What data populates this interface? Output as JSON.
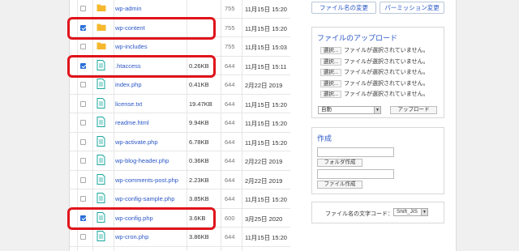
{
  "files": [
    {
      "name": "wp-admin",
      "type": "folder",
      "size": "",
      "perm": "755",
      "date": "11月15日 15:20",
      "checked": false
    },
    {
      "name": "wp-content",
      "type": "folder",
      "size": "",
      "perm": "755",
      "date": "11月15日 15:20",
      "checked": true
    },
    {
      "name": "wp-includes",
      "type": "folder",
      "size": "",
      "perm": "755",
      "date": "11月15日 15:03",
      "checked": false
    },
    {
      "name": ".htaccess",
      "type": "file",
      "size": "0.26KB",
      "perm": "644",
      "date": "11月15日 15:11",
      "checked": true
    },
    {
      "name": "index.php",
      "type": "file",
      "size": "0.41KB",
      "perm": "644",
      "date": "2月22日 2019",
      "checked": false
    },
    {
      "name": "license.txt",
      "type": "file",
      "size": "19.47KB",
      "perm": "644",
      "date": "11月15日 15:20",
      "checked": false
    },
    {
      "name": "readme.html",
      "type": "file",
      "size": "9.94KB",
      "perm": "644",
      "date": "11月15日 15:20",
      "checked": false
    },
    {
      "name": "wp-activate.php",
      "type": "file",
      "size": "6.78KB",
      "perm": "644",
      "date": "11月15日 15:20",
      "checked": false
    },
    {
      "name": "wp-blog-header.php",
      "type": "file",
      "size": "0.36KB",
      "perm": "644",
      "date": "2月22日 2019",
      "checked": false
    },
    {
      "name": "wp-comments-post.php",
      "type": "file",
      "size": "2.23KB",
      "perm": "644",
      "date": "2月22日 2019",
      "checked": false
    },
    {
      "name": "wp-config-sample.php",
      "type": "file",
      "size": "3.85KB",
      "perm": "644",
      "date": "11月15日 15:20",
      "checked": false
    },
    {
      "name": "wp-config.php",
      "type": "file",
      "size": "3.6KB",
      "perm": "600",
      "date": "3月25日 2020",
      "checked": true
    },
    {
      "name": "wp-cron.php",
      "type": "file",
      "size": "3.86KB",
      "perm": "644",
      "date": "11月15日 15:20",
      "checked": false
    }
  ],
  "actions": {
    "rename": "ファイル名の変更",
    "permission": "パーミッション変更"
  },
  "upload": {
    "title": "ファイルのアップロード",
    "select_label": "選択...",
    "no_file_text": "ファイルが選択されていません。",
    "mode_value": "自動",
    "upload_button": "アップロード"
  },
  "create": {
    "title": "作成",
    "folder_button": "フォルダ作成",
    "file_button": "ファイル作成"
  },
  "encoding": {
    "label": "ファイル名の文字コード：",
    "value": "Shift_JIS"
  },
  "colors": {
    "accent": "#2a56c6",
    "highlight": "#e0141b",
    "checkbox": "#2b6fd8",
    "file_icon": "#1aa79c",
    "folder_icon": "#f5b82e"
  }
}
